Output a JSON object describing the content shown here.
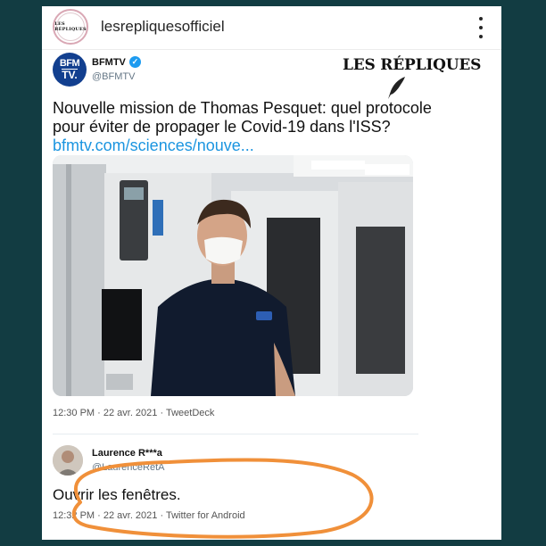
{
  "post": {
    "username": "lesrepliquesofficiel",
    "avatar_text": "LES RÉPLIQUES",
    "watermark": "LES RÉPLIQUES"
  },
  "tweet": {
    "author": "BFMTV",
    "handle": "@BFMTV",
    "logo_line1": "BFM",
    "logo_line2": "TV.",
    "text": "Nouvelle mission de Thomas Pesquet: quel protocole pour éviter de propager le Covid-19 dans l'ISS?",
    "link": "bfmtv.com/sciences/nouve...",
    "meta": "12:30 PM · 22 avr. 2021 · TweetDeck"
  },
  "reply": {
    "author": "Laurence R***a",
    "handle": "@LaurenceRetA",
    "text": "Ouvrir les fenêtres.",
    "meta": "12:32 PM · 22 avr. 2021 · Twitter for Android"
  },
  "colors": {
    "background": "#123c42",
    "link": "#1b95e0",
    "annotation_circle": "#f0903a",
    "bfm_blue": "#123f8f"
  },
  "icons": [
    "more-options-icon",
    "verified-badge-icon",
    "quill-icon"
  ]
}
